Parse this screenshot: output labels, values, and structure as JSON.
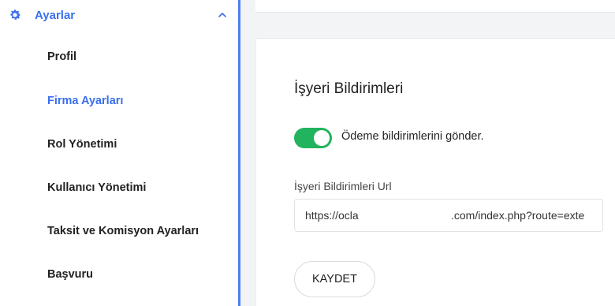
{
  "sidebar": {
    "section_title": "Ayarlar",
    "section_icon": "gear-icon",
    "collapse_icon": "chevron-up-icon",
    "items": [
      {
        "label": "Profil",
        "active": false
      },
      {
        "label": "Firma Ayarları",
        "active": true
      },
      {
        "label": "Rol Yönetimi",
        "active": false
      },
      {
        "label": "Kullanıcı Yönetimi",
        "active": false
      },
      {
        "label": "Taksit ve Komisyon Ayarları",
        "active": false
      },
      {
        "label": "Başvuru",
        "active": false
      }
    ]
  },
  "main": {
    "card_title": "İşyeri Bildirimleri",
    "toggle": {
      "label": "Ödeme bildirimlerini gönder.",
      "on": true
    },
    "url_field": {
      "label": "İşyeri Bildirimleri Url",
      "value_start": "https://ocla",
      "value_end": ".com/index.php?route=exte"
    },
    "save_label": "KAYDET"
  },
  "colors": {
    "accent": "#3a6ff0",
    "toggle_on": "#22b35e",
    "divider": "#4d7ff0"
  }
}
